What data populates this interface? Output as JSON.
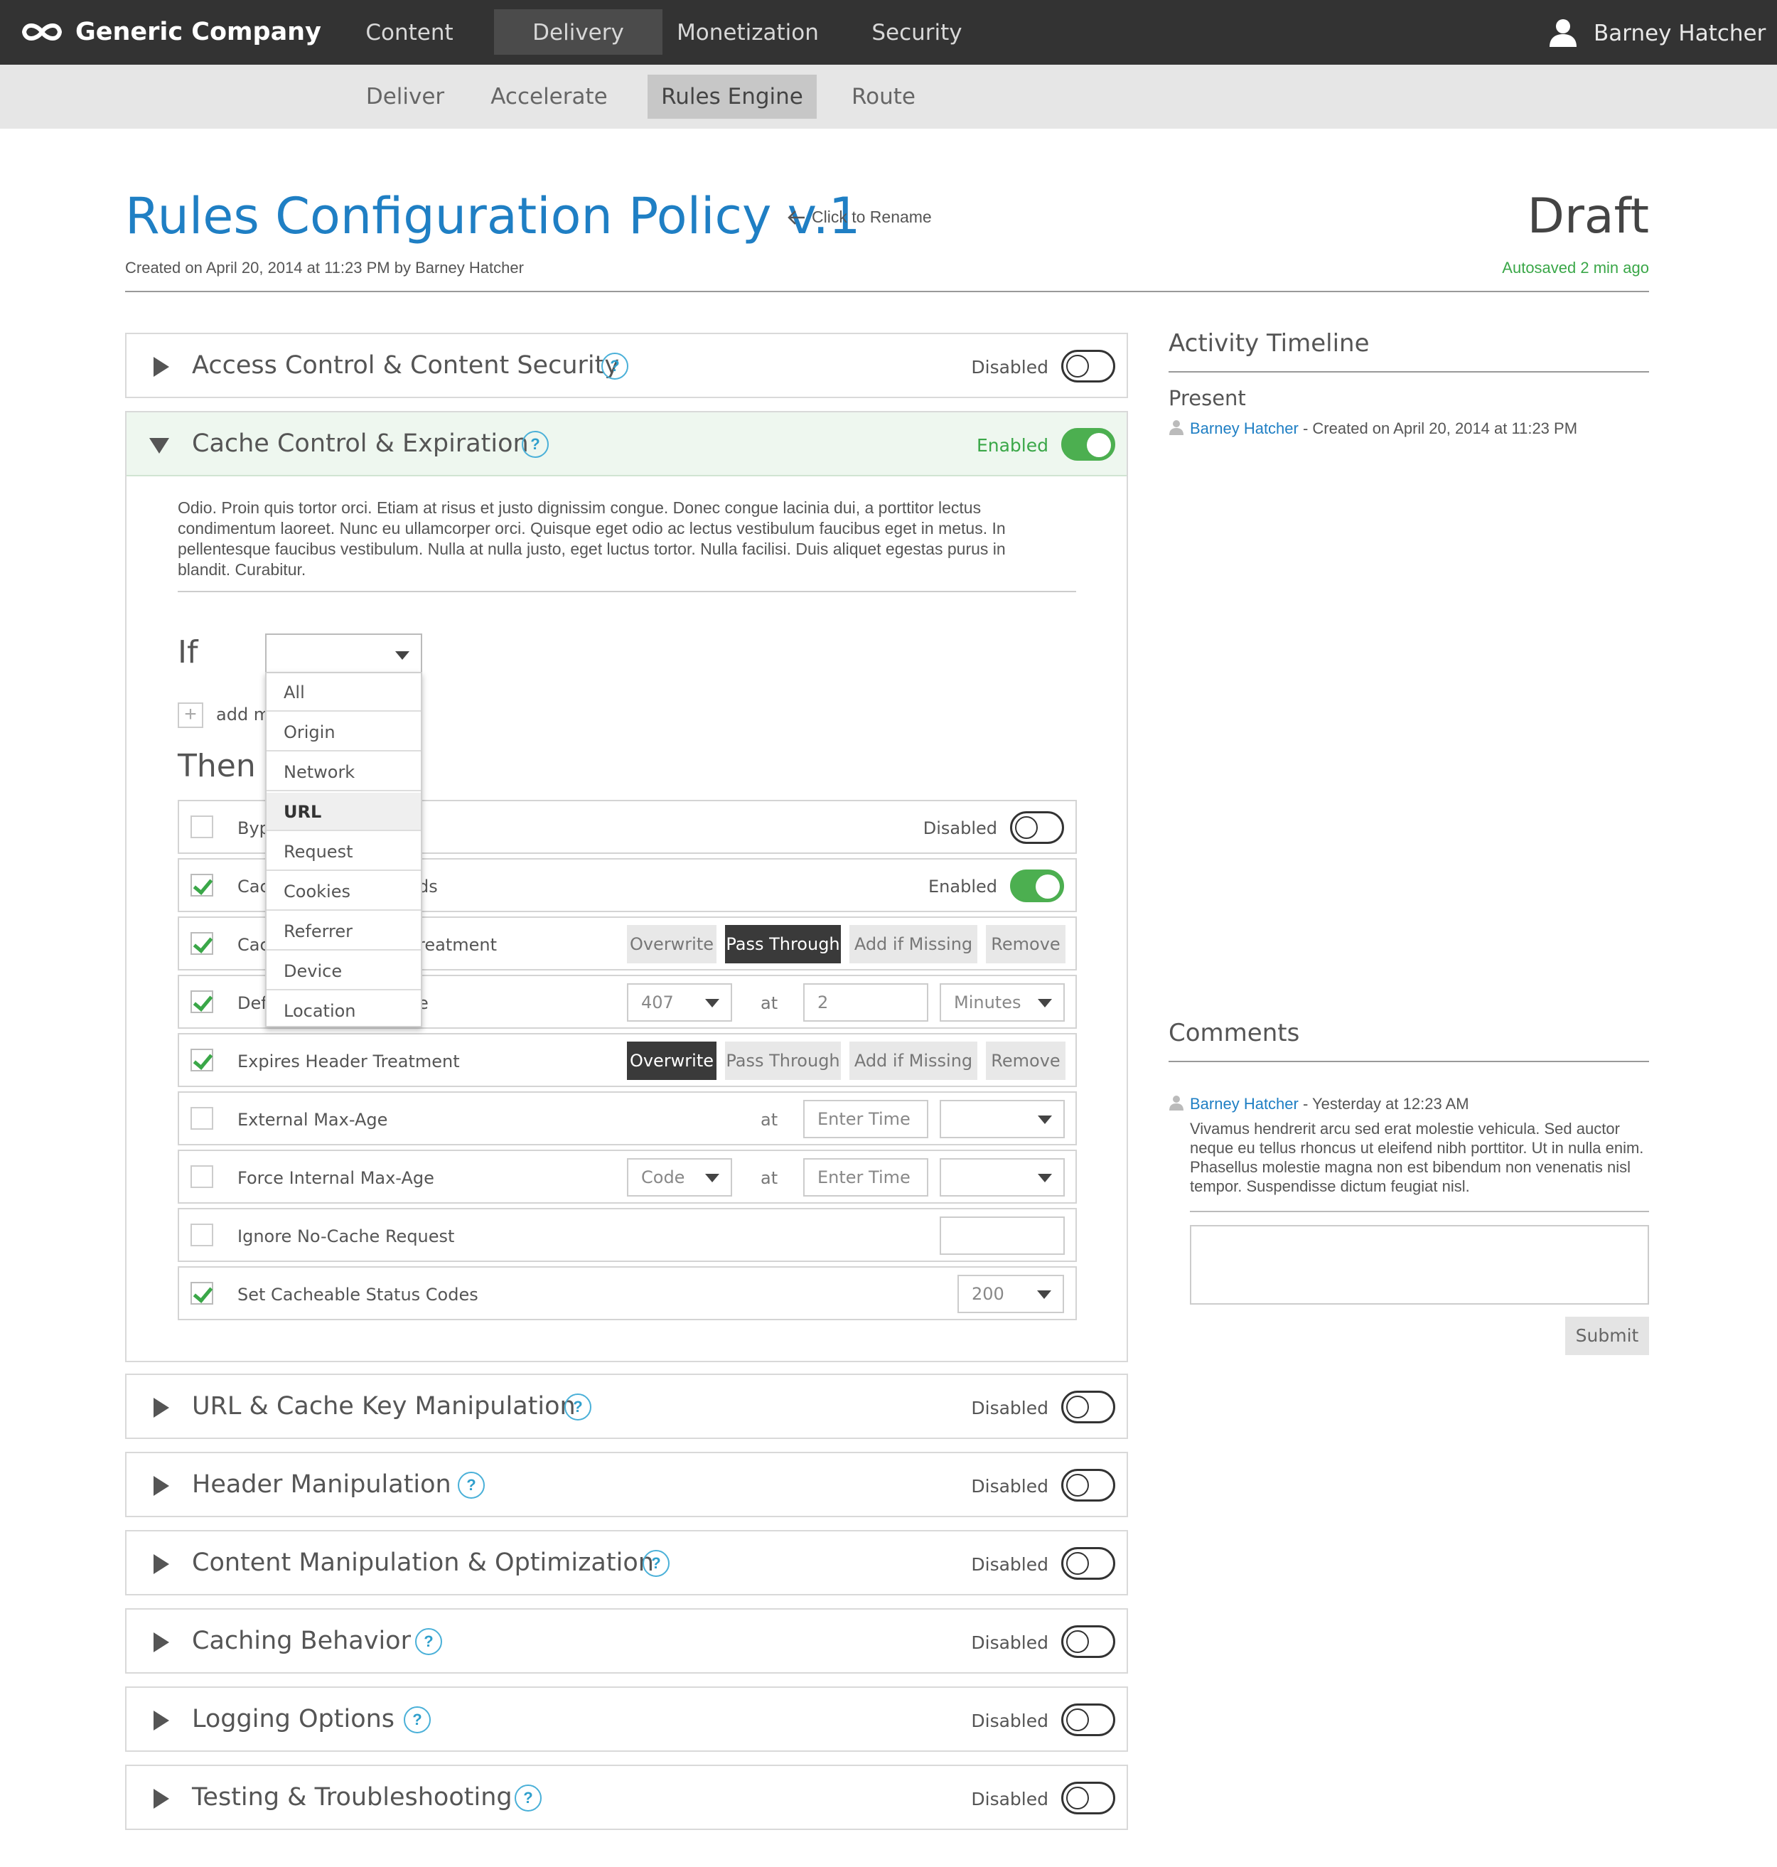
{
  "app": {
    "brand": "Generic Company",
    "nav": [
      "Content",
      "Delivery",
      "Monetization",
      "Security"
    ],
    "nav_active": "Delivery",
    "user": "Barney Hatcher",
    "subnav": [
      "Deliver",
      "Accelerate",
      "Rules Engine",
      "Route"
    ],
    "subnav_active": "Rules Engine"
  },
  "header": {
    "title": "Rules Configuration Policy v.1",
    "rename_hint": "Click to Rename",
    "created": "Created on April 20, 2014 at 11:23 PM by Barney Hatcher",
    "status": "Draft",
    "autosave": "Autosaved 2 min ago"
  },
  "sections": [
    {
      "title": "Access Control & Content Security",
      "state": "Disabled",
      "enabled": false
    },
    {
      "title": "Cache Control & Expiration",
      "state": "Enabled",
      "enabled": true
    },
    {
      "title": "URL & Cache Key Manipulation",
      "state": "Disabled",
      "enabled": false
    },
    {
      "title": "Header Manipulation",
      "state": "Disabled",
      "enabled": false
    },
    {
      "title": "Content Manipulation & Optimization",
      "state": "Disabled",
      "enabled": false
    },
    {
      "title": "Caching Behavior",
      "state": "Disabled",
      "enabled": false
    },
    {
      "title": "Logging Options",
      "state": "Disabled",
      "enabled": false
    },
    {
      "title": "Testing & Troubleshooting",
      "state": "Disabled",
      "enabled": false
    }
  ],
  "cache": {
    "description": "Odio. Proin quis tortor orci. Etiam at risus et justo dignissim congue. Donec congue lacinia dui, a porttitor lectus condimentum laoreet. Nunc eu ullamcorper orci. Quisque eget odio ac lectus vestibulum faucibus eget in metus. In pellentesque faucibus vestibulum. Nulla at nulla justo, eget luctus tortor. Nulla facilisi. Duis aliquet egestas purus in blandit. Curabitur.",
    "if_label": "If",
    "add_more": "add m",
    "then_label": "Then",
    "if_options": [
      "All",
      "Origin",
      "Network",
      "URL",
      "Request",
      "Cookies",
      "Referrer",
      "Device",
      "Location"
    ],
    "if_highlighted": "URL",
    "rows": {
      "bypass": {
        "label": "Byp",
        "state": "Disabled",
        "checked": false
      },
      "cache_ds": {
        "label": "Cac",
        "label_tail": "ds",
        "state": "Enabled",
        "checked": true
      },
      "cache_treatment": {
        "label": "Cac",
        "label_tail": "reatment",
        "checked": true
      },
      "default": {
        "label": "Def",
        "label_tail": "e",
        "checked": true,
        "code": "407",
        "value": "2",
        "unit": "Minutes"
      },
      "expires": {
        "label": "Expires Header Treatment",
        "checked": true
      },
      "external": {
        "label": "External Max-Age",
        "checked": false,
        "placeholder": "Enter Time"
      },
      "force": {
        "label": "Force Internal Max-Age",
        "checked": false,
        "code": "Code",
        "placeholder": "Enter Time"
      },
      "ignore": {
        "label": "Ignore No-Cache Request",
        "checked": false
      },
      "status_codes": {
        "label": "Set Cacheable Status Codes",
        "checked": true,
        "value": "200"
      }
    },
    "treatment_options": [
      "Overwrite",
      "Pass Through",
      "Add if Missing",
      "Remove"
    ],
    "at": "at"
  },
  "timeline": {
    "title": "Activity Timeline",
    "present": "Present",
    "entry_user": "Barney Hatcher",
    "entry_text": " - Created on April 20, 2014 at 11:23 PM"
  },
  "comments": {
    "title": "Comments",
    "user": "Barney Hatcher",
    "time": " - Yesterday at 12:23 AM",
    "body": "Vivamus hendrerit arcu sed erat molestie vehicula. Sed auctor neque eu tellus rhoncus ut eleifend nibh porttitor. Ut in nulla enim. Phasellus molestie magna non est bibendum non venenatis nisl tempor. Suspendisse dictum feugiat nisl.",
    "submit": "Submit"
  },
  "colors": {
    "accent": "#1f7fc4",
    "enabled": "#4caf50",
    "autosave": "#3aa748"
  }
}
